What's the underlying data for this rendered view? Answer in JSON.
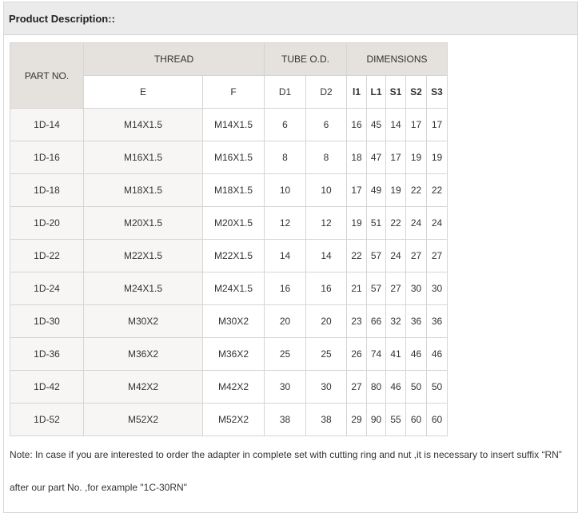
{
  "header": {
    "title": "Product Description::"
  },
  "table": {
    "group_headers": {
      "part_no": "PART NO.",
      "thread": "THREAD",
      "tube_od": "TUBE O.D.",
      "dimensions": "DIMENSIONS"
    },
    "sub_headers": [
      "E",
      "F",
      "D1",
      "D2",
      "l1",
      "L1",
      "S1",
      "S2",
      "S3"
    ],
    "rows": [
      [
        "1D-14",
        "M14X1.5",
        "M14X1.5",
        "6",
        "6",
        "16",
        "45",
        "14",
        "17",
        "17"
      ],
      [
        "1D-16",
        "M16X1.5",
        "M16X1.5",
        "8",
        "8",
        "18",
        "47",
        "17",
        "19",
        "19"
      ],
      [
        "1D-18",
        "M18X1.5",
        "M18X1.5",
        "10",
        "10",
        "17",
        "49",
        "19",
        "22",
        "22"
      ],
      [
        "1D-20",
        "M20X1.5",
        "M20X1.5",
        "12",
        "12",
        "19",
        "51",
        "22",
        "24",
        "24"
      ],
      [
        "1D-22",
        "M22X1.5",
        "M22X1.5",
        "14",
        "14",
        "22",
        "57",
        "24",
        "27",
        "27"
      ],
      [
        "1D-24",
        "M24X1.5",
        "M24X1.5",
        "16",
        "16",
        "21",
        "57",
        "27",
        "30",
        "30"
      ],
      [
        "1D-30",
        "M30X2",
        "M30X2",
        "20",
        "20",
        "23",
        "66",
        "32",
        "36",
        "36"
      ],
      [
        "1D-36",
        "M36X2",
        "M36X2",
        "25",
        "25",
        "26",
        "74",
        "41",
        "46",
        "46"
      ],
      [
        "1D-42",
        "M42X2",
        "M42X2",
        "30",
        "30",
        "27",
        "80",
        "46",
        "50",
        "50"
      ],
      [
        "1D-52",
        "M52X2",
        "M52X2",
        "38",
        "38",
        "29",
        "90",
        "55",
        "60",
        "60"
      ]
    ]
  },
  "note": {
    "line1": "Note: In case if you are interested to order the adapter in complete set with cutting ring and nut ,it is necessary to insert suffix “RN”",
    "line2": "after our part No. ,for example \"1C-30RN\""
  },
  "colors": {
    "header_band": "#ebebeb",
    "table_header_fill": "#e5e1dc",
    "alt_cell_fill": "#f7f6f4",
    "border": "#d5d5d5",
    "text": "#333333"
  }
}
